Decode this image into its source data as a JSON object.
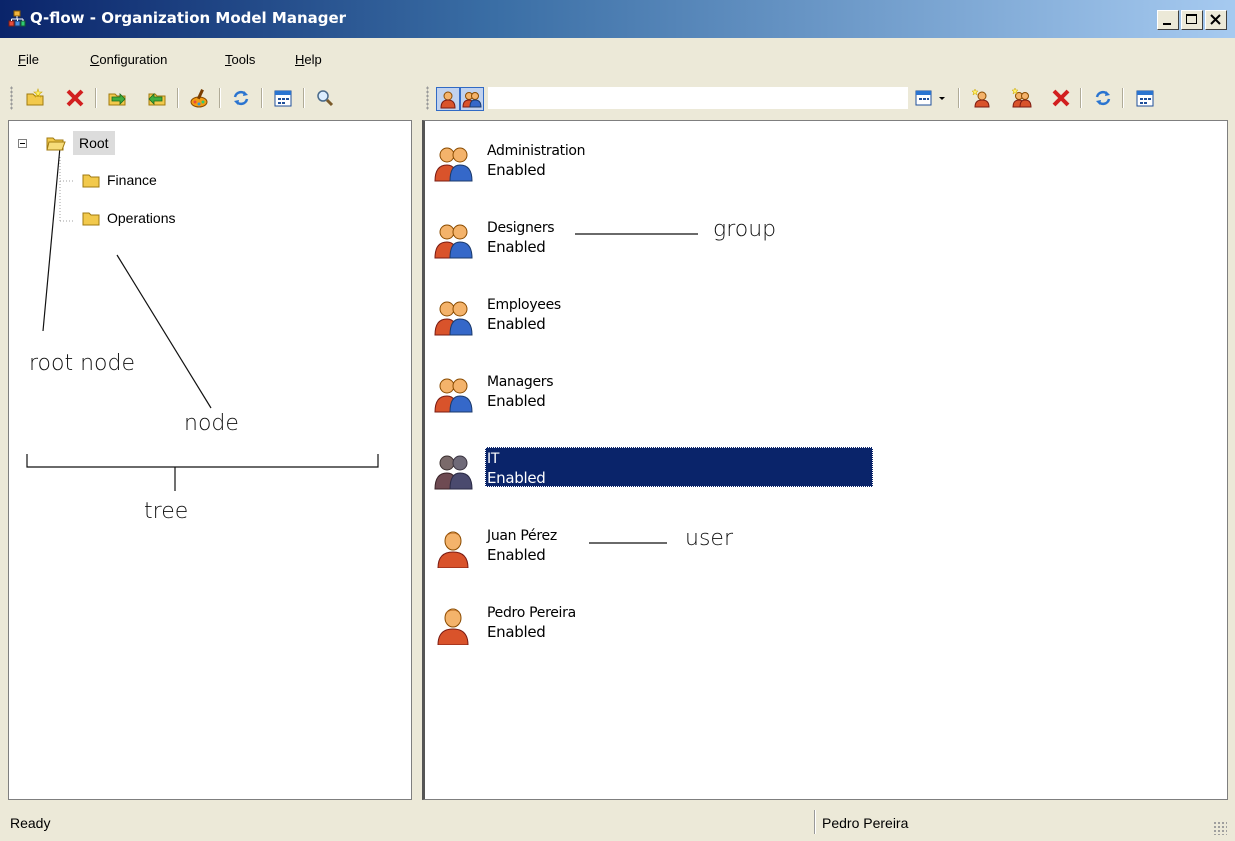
{
  "window": {
    "title": "Q-flow - Organization Model Manager",
    "controls": [
      "minimize",
      "maximize",
      "close"
    ]
  },
  "menu": [
    {
      "label": "File",
      "mnemonic": "F",
      "rest": "ile"
    },
    {
      "label": "Configuration",
      "mnemonic": "C",
      "rest": "onfiguration"
    },
    {
      "label": "Tools",
      "mnemonic": "T",
      "rest": "ools"
    },
    {
      "label": "Help",
      "mnemonic": "H",
      "rest": "elp"
    }
  ],
  "toolbar_left": {
    "icons": [
      "new-folder-icon",
      "delete-icon",
      "move-icon",
      "copy-icon",
      "paint-icon",
      "refresh-icon",
      "calendar-icon",
      "search-icon"
    ]
  },
  "toolbar_right": {
    "icons": [
      "show-users-icon",
      "show-groups-icon",
      "calendar-dropdown-icon",
      "new-user-icon",
      "new-group-icon",
      "delete-icon",
      "refresh-icon",
      "calendar-icon"
    ]
  },
  "tree": {
    "root": "Root",
    "children": [
      "Finance",
      "Operations"
    ]
  },
  "list": [
    {
      "name": "Administration",
      "status": "Enabled",
      "type": "group",
      "selected": false
    },
    {
      "name": "Designers",
      "status": "Enabled",
      "type": "group",
      "selected": false
    },
    {
      "name": "Employees",
      "status": "Enabled",
      "type": "group",
      "selected": false
    },
    {
      "name": "Managers",
      "status": "Enabled",
      "type": "group",
      "selected": false
    },
    {
      "name": "IT",
      "status": "Enabled",
      "type": "group",
      "selected": true
    },
    {
      "name": "Juan Pérez",
      "status": "Enabled",
      "type": "user",
      "selected": false
    },
    {
      "name": "Pedro Pereira",
      "status": "Enabled",
      "type": "user",
      "selected": false
    }
  ],
  "annotations": {
    "root_node": "root node",
    "node": "node",
    "tree": "tree",
    "group": "group",
    "user": "user"
  },
  "statusbar": {
    "left": "Ready",
    "right": "Pedro Pereira"
  },
  "colors": {
    "selection": "#0a246a",
    "folder": "#f2c94c",
    "delete": "#d21f1f"
  }
}
